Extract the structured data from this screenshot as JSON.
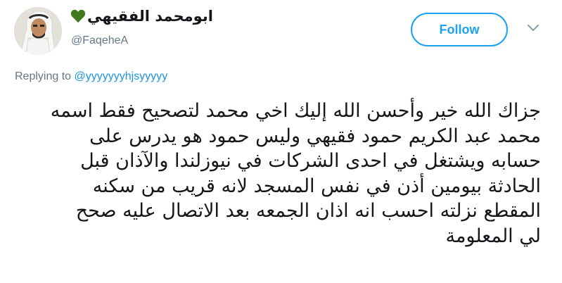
{
  "user": {
    "display_name": "ابومحمد الفقيهي",
    "handle": "@FaqeheA",
    "name_emoji_icon": "green-heart-icon",
    "heart_color": "#3f7a1f"
  },
  "follow_button": {
    "label": "Follow"
  },
  "menu": {
    "icon": "chevron-down-icon"
  },
  "reply": {
    "prefix": "Replying to",
    "target": "@yyyyyyyhjsyyyyy"
  },
  "tweet": {
    "lines": [
      "جزاك الله خير وأحسن الله إليك اخي محمد لتصحيح فقط اسمه",
      "محمد عبد الكريم حمود فقيهي وليس حمود هو يدرس على",
      "حسابه ويشتغل في احدى الشركات في نيوزلندا والآذان قبل",
      "الحادثة بيومين أذن في نفس المسجد لانه قريب من سكنه",
      "المقطع نزلته احسب انه اذان الجمعه بعد الاتصال عليه صحح",
      "لي المعلومة"
    ]
  },
  "colors": {
    "accent": "#1da1f2",
    "link": "#1b95e0",
    "secondary_text": "#657786",
    "primary_text": "#14171a"
  }
}
